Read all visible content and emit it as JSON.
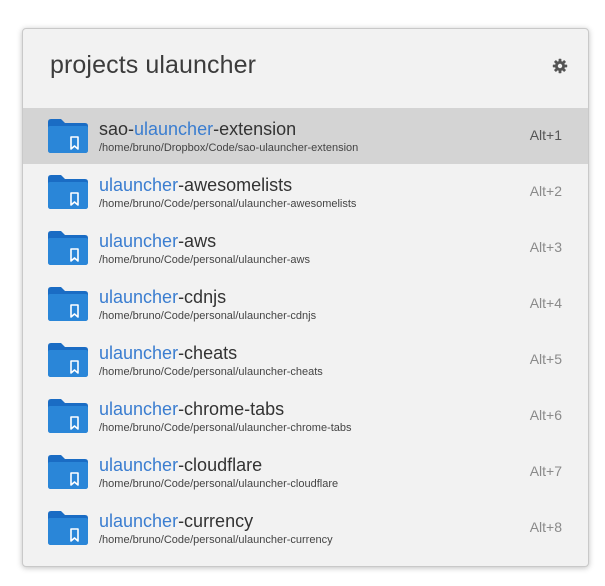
{
  "search": {
    "query": "projects ulauncher"
  },
  "header": {
    "prefs_icon": "gear-icon"
  },
  "colors": {
    "highlight": "#3a7dd0",
    "folder": "#2a86d8",
    "selected_bg": "#d4d4d4"
  },
  "results": [
    {
      "pre": "sao-",
      "match": "ulauncher",
      "post": "-extension",
      "path": "/home/bruno/Dropbox/Code/sao-ulauncher-extension",
      "shortcut": "Alt+1",
      "selected": true,
      "icon": "folder-icon"
    },
    {
      "pre": "",
      "match": "ulauncher",
      "post": "-awesomelists",
      "path": "/home/bruno/Code/personal/ulauncher-awesomelists",
      "shortcut": "Alt+2",
      "selected": false,
      "icon": "folder-icon"
    },
    {
      "pre": "",
      "match": "ulauncher",
      "post": "-aws",
      "path": "/home/bruno/Code/personal/ulauncher-aws",
      "shortcut": "Alt+3",
      "selected": false,
      "icon": "folder-icon"
    },
    {
      "pre": "",
      "match": "ulauncher",
      "post": "-cdnjs",
      "path": "/home/bruno/Code/personal/ulauncher-cdnjs",
      "shortcut": "Alt+4",
      "selected": false,
      "icon": "folder-icon"
    },
    {
      "pre": "",
      "match": "ulauncher",
      "post": "-cheats",
      "path": "/home/bruno/Code/personal/ulauncher-cheats",
      "shortcut": "Alt+5",
      "selected": false,
      "icon": "folder-icon"
    },
    {
      "pre": "",
      "match": "ulauncher",
      "post": "-chrome-tabs",
      "path": "/home/bruno/Code/personal/ulauncher-chrome-tabs",
      "shortcut": "Alt+6",
      "selected": false,
      "icon": "folder-icon"
    },
    {
      "pre": "",
      "match": "ulauncher",
      "post": "-cloudflare",
      "path": "/home/bruno/Code/personal/ulauncher-cloudflare",
      "shortcut": "Alt+7",
      "selected": false,
      "icon": "folder-icon"
    },
    {
      "pre": "",
      "match": "ulauncher",
      "post": "-currency",
      "path": "/home/bruno/Code/personal/ulauncher-currency",
      "shortcut": "Alt+8",
      "selected": false,
      "icon": "folder-icon"
    }
  ]
}
